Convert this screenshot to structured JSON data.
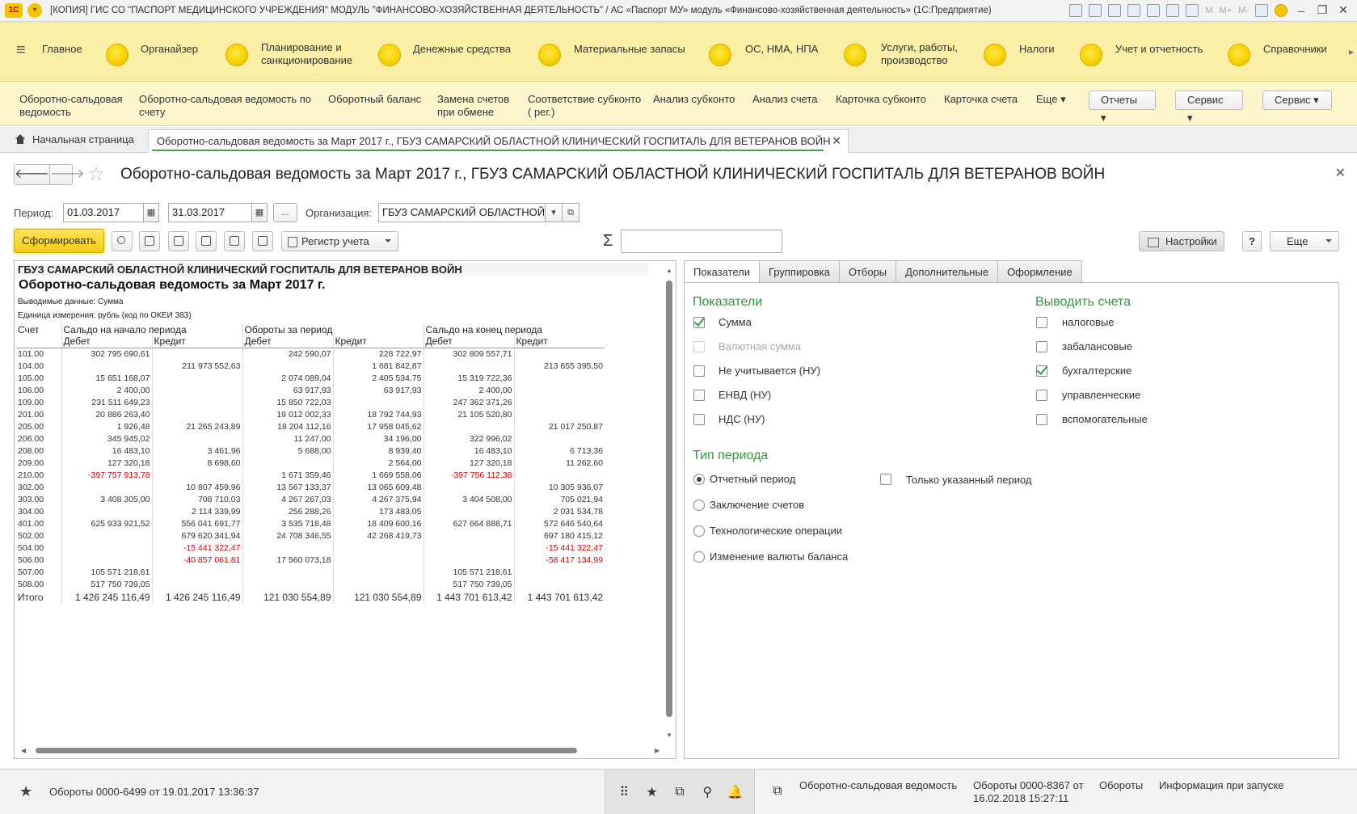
{
  "window": {
    "title": "[КОПИЯ] ГИС СО \"ПАСПОРТ МЕДИЦИНСКОГО УЧРЕЖДЕНИЯ\" МОДУЛЬ \"ФИНАНСОВО-ХОЗЯЙСТВЕННАЯ ДЕЯТЕЛЬНОСТЬ\" / АС «Паспорт МУ» модуль «Финансово-хозяйственная деятельность» (1С:Предприятие)",
    "logo_text": "1С",
    "tools_text": [
      "M",
      "M+",
      "M-"
    ]
  },
  "sections": [
    {
      "label": "Главное"
    },
    {
      "label": "Органайзер"
    },
    {
      "label": "Планирование и санкционирование"
    },
    {
      "label": "Денежные средства"
    },
    {
      "label": "Материальные запасы"
    },
    {
      "label": "ОС, НМА, НПА"
    },
    {
      "label": "Услуги, работы, производство"
    },
    {
      "label": "Налоги"
    },
    {
      "label": "Учет и отчетность"
    },
    {
      "label": "Справочники"
    }
  ],
  "commands": {
    "items": [
      "Оборотно-сальдовая ведомость",
      "Оборотно-сальдовая ведомость по счету",
      "Оборотный баланс",
      "Замена счетов при обмене",
      "Соответствие субконто ( рег.)",
      "Анализ субконто",
      "Анализ счета",
      "Карточка субконто",
      "Карточка счета",
      "Еще"
    ],
    "reports_btn": "Отчеты",
    "service_btn": "Сервис",
    "service2_btn": "Сервис"
  },
  "tabs": {
    "home": "Начальная страница",
    "active": "Оборотно-сальдовая ведомость за Март 2017 г., ГБУЗ САМАРСКИЙ ОБЛАСТНОЙ КЛИНИЧЕСКИЙ ГОСПИТАЛЬ ДЛЯ ВЕТЕРАНОВ ВОЙН"
  },
  "form": {
    "title": "Оборотно-сальдовая ведомость за Март 2017 г., ГБУЗ САМАРСКИЙ ОБЛАСТНОЙ КЛИНИЧЕСКИЙ ГОСПИТАЛЬ ДЛЯ ВЕТЕРАНОВ ВОЙН",
    "period_label": "Период:",
    "date_from": "01.03.2017",
    "date_to": "31.03.2017",
    "dots": "...",
    "org_label": "Организация:",
    "org_value": "ГБУЗ САМАРСКИЙ ОБЛАСТНОЙ",
    "generate_btn": "Сформировать",
    "register_btn": "Регистр учета",
    "sigma": "Σ",
    "settings_btn": "Настройки",
    "help_btn": "?",
    "more_btn": "Еще"
  },
  "report": {
    "org": "ГБУЗ САМАРСКИЙ ОБЛАСТНОЙ КЛИНИЧЕСКИЙ ГОСПИТАЛЬ ДЛЯ ВЕТЕРАНОВ ВОЙН",
    "title": "Оборотно-сальдовая ведомость за Март 2017 г.",
    "output": "Выводимые данные:  Сумма",
    "unit": "Единица измерения: рубль (код по ОКЕИ 383)",
    "h_account": "Счет",
    "h_open": "Сальдо на начало периода",
    "h_turn": "Обороты за период",
    "h_close": "Сальдо на конец периода",
    "h_debit": "Дебет",
    "h_credit": "Кредит",
    "rows": [
      [
        "101.00",
        "302 795 690,61",
        "",
        "242 590,07",
        "228 722,97",
        "302 809 557,71",
        ""
      ],
      [
        "104.00",
        "",
        "211 973 552,63",
        "",
        "1 681 842,87",
        "",
        "213 655 395,50"
      ],
      [
        "105.00",
        "15 651 168,07",
        "",
        "2 074 089,04",
        "2 405 534,75",
        "15 319 722,36",
        ""
      ],
      [
        "106.00",
        "2 400,00",
        "",
        "63 917,93",
        "63 917,93",
        "2 400,00",
        ""
      ],
      [
        "109.00",
        "231 511 649,23",
        "",
        "15 850 722,03",
        "",
        "247 362 371,26",
        ""
      ],
      [
        "201.00",
        "20 886 263,40",
        "",
        "19 012 002,33",
        "18 792 744,93",
        "21 105 520,80",
        ""
      ],
      [
        "205.00",
        "1 926,48",
        "21 265 243,89",
        "18 204 112,16",
        "17 958 045,62",
        "",
        "21 017 250,87"
      ],
      [
        "206.00",
        "345 945,02",
        "",
        "11 247,00",
        "34 196,00",
        "322 996,02",
        ""
      ],
      [
        "208.00",
        "16 483,10",
        "3 461,96",
        "5 688,00",
        "8 939,40",
        "16 483,10",
        "6 713,36"
      ],
      [
        "209.00",
        "127 320,18",
        "8 698,60",
        "",
        "2 564,00",
        "127 320,18",
        "11 262,60"
      ],
      [
        "210.00",
        "-397 757 913,78",
        "",
        "1 671 359,46",
        "1 669 558,06",
        "-397 756 112,38",
        ""
      ],
      [
        "302.00",
        "",
        "10 807 459,96",
        "13 567 133,37",
        "13 065 609,48",
        "",
        "10 305 936,07"
      ],
      [
        "303.00",
        "3 408 305,00",
        "708 710,03",
        "4 267 267,03",
        "4 267 375,94",
        "3 404 508,00",
        "705 021,94"
      ],
      [
        "304.00",
        "",
        "2 114 339,99",
        "256 288,26",
        "173 483,05",
        "",
        "2 031 534,78"
      ],
      [
        "401.00",
        "625 933 921,52",
        "556 041 691,77",
        "3 535 718,48",
        "18 409 600,16",
        "627 664 888,71",
        "572 646 540,64"
      ],
      [
        "502.00",
        "",
        "679 620 341,94",
        "24 708 346,55",
        "42 268 419,73",
        "",
        "697 180 415,12"
      ],
      [
        "504.00",
        "",
        "-15 441 322,47",
        "",
        "",
        "",
        "-15 441 322,47"
      ],
      [
        "506.00",
        "",
        "-40 857 061,81",
        "17 560 073,18",
        "",
        "",
        "-58 417 134,99"
      ],
      [
        "507.00",
        "105 571 218,61",
        "",
        "",
        "",
        "105 571 218,61",
        ""
      ],
      [
        "508.00",
        "517 750 739,05",
        "",
        "",
        "",
        "517 750 739,05",
        ""
      ]
    ],
    "total": [
      "Итого",
      "1 426 245 116,49",
      "1 426 245 116,49",
      "121 030 554,89",
      "121 030 554,89",
      "1 443 701 613,42",
      "1 443 701 613,42"
    ]
  },
  "settings": {
    "tabs": [
      "Показатели",
      "Группировка",
      "Отборы",
      "Дополнительные",
      "Оформление"
    ],
    "indicators_title": "Показатели",
    "indicators": [
      {
        "label": "Сумма",
        "checked": true,
        "disabled": false
      },
      {
        "label": "Валютная сумма",
        "checked": false,
        "disabled": true
      },
      {
        "label": "Не учитывается (НУ)",
        "checked": false,
        "disabled": false
      },
      {
        "label": "ЕНВД (НУ)",
        "checked": false,
        "disabled": false
      },
      {
        "label": "НДС (НУ)",
        "checked": false,
        "disabled": false
      }
    ],
    "accounts_title": "Выводить счета",
    "accounts": [
      {
        "label": "налоговые",
        "checked": false
      },
      {
        "label": "забалансовые",
        "checked": false
      },
      {
        "label": "бухгалтерские",
        "checked": true
      },
      {
        "label": "управленческие",
        "checked": false
      },
      {
        "label": "вспомогательные",
        "checked": false
      }
    ],
    "period_type_title": "Тип периода",
    "period_types": [
      {
        "label": "Отчетный период",
        "selected": true
      },
      {
        "label": "Заключение счетов",
        "selected": false
      },
      {
        "label": "Технологические операции",
        "selected": false
      },
      {
        "label": "Изменение валюты баланса",
        "selected": false
      }
    ],
    "only_period": "Только указанный период"
  },
  "status": {
    "left": "Обороты 0000-6499 от 19.01.2017 13:36:37",
    "hist1": "Оборотно-сальдовая ведомость",
    "hist2": "Обороты 0000-8367 от 16.02.2018 15:27:11",
    "hist3": "Обороты",
    "hist4": "Информация при запуске"
  }
}
